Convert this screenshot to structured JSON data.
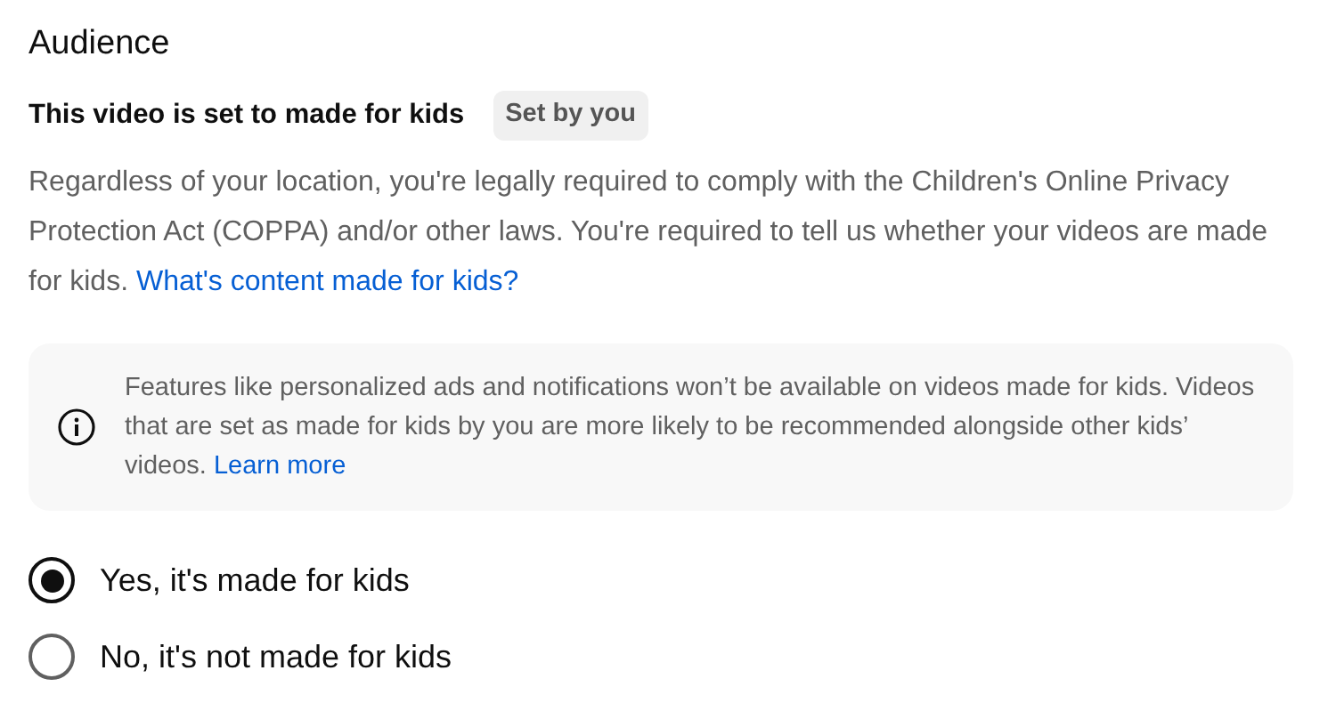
{
  "section": {
    "title": "Audience"
  },
  "status": {
    "text": "This video is set to made for kids",
    "chip": "Set by you"
  },
  "description": {
    "text": "Regardless of your location, you're legally required to comply with the Children's Online Privacy Protection Act (COPPA) and/or other laws. You're required to tell us whether your videos are made for kids.",
    "link": "What's content made for kids?"
  },
  "notice": {
    "text": "Features like personalized ads and notifications won’t be available on videos made for kids. Videos that are set as made for kids by you are more likely to be recommended alongside other kids’ videos.",
    "link": "Learn more"
  },
  "options": [
    {
      "label": "Yes, it's made for kids",
      "selected": true
    },
    {
      "label": "No, it's not made for kids",
      "selected": false
    }
  ]
}
